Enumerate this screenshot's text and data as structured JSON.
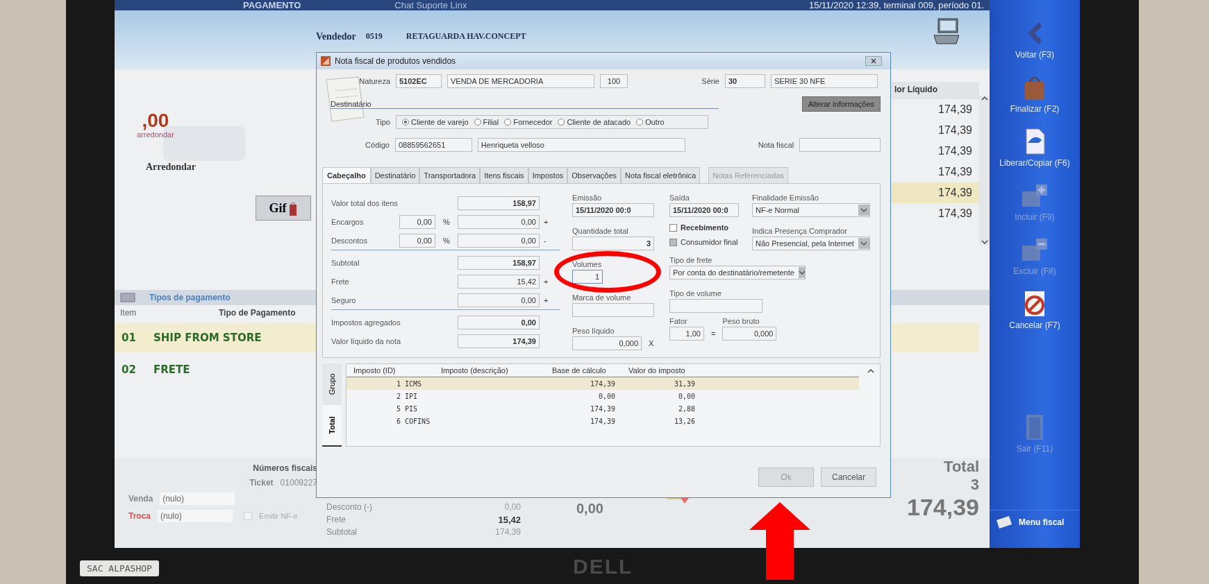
{
  "photo": {
    "sticky_note": "SAC ALPASHOP",
    "monitor_brand": "DELL"
  },
  "app": {
    "screen_title": "PAGAMENTO",
    "chat_link": "Chat Suporte Linx",
    "status": "15/11/2020 12:39, terminal 009, período 01.",
    "vendedor": {
      "label": "Vendedor",
      "code": "0519",
      "name": "RETAGUARDA HAV.CONCEPT"
    },
    "arredondar": {
      "logo_value": ",00",
      "logo_text": "arredondar",
      "button": "Arredondar"
    },
    "gift_card": "Gif",
    "items_header": "lor Líquido",
    "items": [
      {
        "value": "174,39",
        "selected": false
      },
      {
        "value": "174,39",
        "selected": false
      },
      {
        "value": "174,39",
        "selected": false
      },
      {
        "value": "174,39",
        "selected": false
      },
      {
        "value": "174,39",
        "selected": true
      },
      {
        "value": "174,39",
        "selected": false
      }
    ],
    "payments": {
      "title": "Tipos de pagamento",
      "columns": [
        "Item",
        "Tipo de Pagamento"
      ],
      "rows": [
        {
          "item": "01",
          "type": "SHIP FROM STORE",
          "selected": true
        },
        {
          "item": "02",
          "type": "FRETE",
          "selected": false
        }
      ]
    },
    "fiscal": {
      "title": "Números fiscais",
      "ticket_label": "Ticket",
      "ticket": "01009227",
      "venda_label": "Venda",
      "venda": "(nulo)",
      "troca_label": "Troca",
      "troca": "(nulo)",
      "emitir": {
        "label": "Emitir NF-e",
        "checked": false
      }
    },
    "summary": [
      {
        "label": "Desconto (-)",
        "value": "0,00",
        "bold": false
      },
      {
        "label": "Frete",
        "value": "15,42",
        "bold": true
      },
      {
        "label": "Subtotal",
        "value": "174,39",
        "bold": false
      }
    ],
    "change_value": "0,00",
    "total": {
      "label": "Total",
      "count": "3",
      "amount": "174,39"
    },
    "sidebar": [
      {
        "label": "Voltar (F3)",
        "kind": "back",
        "disabled": false
      },
      {
        "label": "Finalizar (F2)",
        "kind": "bag",
        "disabled": false
      },
      {
        "label": "Liberar/Copiar (F6)",
        "kind": "copy",
        "disabled": false
      },
      {
        "label": "Incluir (F9)",
        "kind": "add",
        "disabled": true
      },
      {
        "label": "Excluir (F8)",
        "kind": "remove",
        "disabled": true
      },
      {
        "label": "Cancelar (F7)",
        "kind": "cancel",
        "disabled": false
      },
      {
        "label": "Sair (F11)",
        "kind": "exit",
        "disabled": true
      }
    ],
    "sidebar_footer": "Menu fiscal"
  },
  "dialog": {
    "title": "Nota fiscal de produtos vendidos",
    "natureza": {
      "label": "Natureza",
      "code": "5102EC",
      "description": "VENDA DE MERCADORIA",
      "number": "100"
    },
    "serie": {
      "label": "Série",
      "code": "30",
      "description": "SERIE 30 NFE"
    },
    "destinatario_label": "Destinatário",
    "alter_button": "Alterar informações",
    "tipo": {
      "label": "Tipo",
      "options": [
        {
          "label": "Cliente de varejo",
          "selected": true
        },
        {
          "label": "Filial",
          "selected": false
        },
        {
          "label": "Fornecedor",
          "selected": false
        },
        {
          "label": "Cliente de atacado",
          "selected": false
        },
        {
          "label": "Outro",
          "selected": false
        }
      ]
    },
    "codigo": {
      "label": "Código",
      "value": "08859562651",
      "name": "Henriqueta velloso"
    },
    "nota_fiscal": {
      "label": "Nota fiscal"
    },
    "tabs": [
      {
        "label": "Cabeçalho",
        "selected": true,
        "disabled": false
      },
      {
        "label": "Destinatário",
        "selected": false,
        "disabled": false
      },
      {
        "label": "Transportadora",
        "selected": false,
        "disabled": false
      },
      {
        "label": "Itens fiscais",
        "selected": false,
        "disabled": false
      },
      {
        "label": "Impostos",
        "selected": false,
        "disabled": false
      },
      {
        "label": "Observações",
        "selected": false,
        "disabled": false
      },
      {
        "label": "Nota fiscal eletrônica",
        "selected": false,
        "disabled": false
      },
      {
        "label": "Notas Referenciadas",
        "selected": false,
        "disabled": true
      }
    ],
    "totals": [
      {
        "label": "Valor total dos itens",
        "value": "158,97",
        "bold": true,
        "divider": false
      },
      {
        "label": "Encargos",
        "rate": "0,00",
        "unit": "%",
        "value": "0,00",
        "sign": "+",
        "bold": false,
        "divider": false
      },
      {
        "label": "Descontos",
        "rate": "0,00",
        "unit": "%",
        "value": "0,00",
        "sign": "-",
        "bold": false,
        "divider": true
      },
      {
        "label": "Subtotal",
        "value": "158,97",
        "bold": true,
        "divider": false
      },
      {
        "label": "Frete",
        "value": "15,42",
        "sign": "+",
        "bold": false,
        "divider": false
      },
      {
        "label": "Seguro",
        "value": "0,00",
        "sign": "+",
        "bold": false,
        "divider": true
      },
      {
        "label": "Impostos agregados",
        "value": "0,00",
        "bold": true,
        "divider": false
      },
      {
        "label": "Valor líquido da nota",
        "value": "174,39",
        "bold": true,
        "divider": false
      }
    ],
    "emissao": {
      "label": "Emissão",
      "value": "15/11/2020 00:0"
    },
    "quantidade": {
      "label": "Quantidade total",
      "value": "3"
    },
    "volumes": {
      "label": "Volumes",
      "value": "1"
    },
    "marca": {
      "label": "Marca de volume"
    },
    "peso_liquido": {
      "label": "Peso líquido",
      "value": "0,000"
    },
    "times": "X",
    "saida": {
      "label": "Saída",
      "value": "15/11/2020 00:0"
    },
    "recebimento": {
      "label": "Recebimento",
      "checked": false
    },
    "consumidor": {
      "label": "Consumidor final",
      "checked": true
    },
    "tipo_frete": {
      "label": "Tipo de frete",
      "value": "Por conta do destinatário/remetente"
    },
    "tipo_volume": {
      "label": "Tipo de volume"
    },
    "fator": {
      "label": "Fator",
      "value": "1,00"
    },
    "equals": "=",
    "finalidade": {
      "label": "Finalidade Emissão",
      "value": "NF-e Normal"
    },
    "presenca": {
      "label": "Indica Presença Comprador",
      "value": "Não Presencial, pela Internet"
    },
    "peso_bruto": {
      "label": "Peso bruto",
      "value": "0,000"
    },
    "side_tabs": [
      {
        "label": "Grupo",
        "selected": false
      },
      {
        "label": "Total",
        "selected": true
      }
    ],
    "tax_table": {
      "columns": [
        "Imposto (ID)",
        "Imposto (descrição)",
        "Base de cálculo",
        "Valor do imposto"
      ],
      "rows": [
        {
          "tax": "1 ICMS",
          "base": "174,39",
          "value": "31,39",
          "selected": true
        },
        {
          "tax": "2 IPI",
          "base": "0,00",
          "value": "0,00",
          "selected": false
        },
        {
          "tax": "5 PIS",
          "base": "174,39",
          "value": "2,88",
          "selected": false
        },
        {
          "tax": "6 COFINS",
          "base": "174,39",
          "value": "13,26",
          "selected": false
        }
      ]
    },
    "buttons": [
      {
        "label": "Ok",
        "disabled": true
      },
      {
        "label": "Cancelar",
        "disabled": false
      }
    ]
  }
}
